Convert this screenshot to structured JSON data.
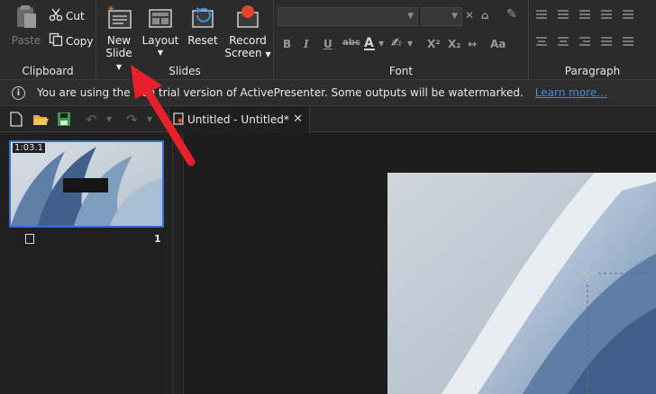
{
  "ribbon": {
    "clipboard": {
      "label": "Clipboard",
      "paste": "Paste",
      "cut": "Cut",
      "copy": "Copy"
    },
    "slides": {
      "label": "Slides",
      "new_slide_line1": "New",
      "new_slide_line2": "Slide",
      "layout": "Layout",
      "reset": "Reset",
      "record_line1": "Record",
      "record_line2": "Screen"
    },
    "font": {
      "label": "Font",
      "bold": "B",
      "italic": "I",
      "underline": "U",
      "strike": "abc",
      "superscript": "X²",
      "subscript": "X₂"
    },
    "paragraph": {
      "label": "Paragraph"
    }
  },
  "infobar": {
    "message": "You are using the free trial version of ActivePresenter. Some outputs will be watermarked.",
    "link": "Learn more..."
  },
  "document_tab": {
    "title": "Untitled - Untitled*"
  },
  "slide_panel": {
    "slides": [
      {
        "duration": "1:03.1",
        "number": "1"
      }
    ]
  },
  "colors": {
    "selection": "#3a6ecf",
    "link": "#3c8fe0",
    "annotation_arrow": "#e8202a",
    "record": "#e8442a"
  }
}
